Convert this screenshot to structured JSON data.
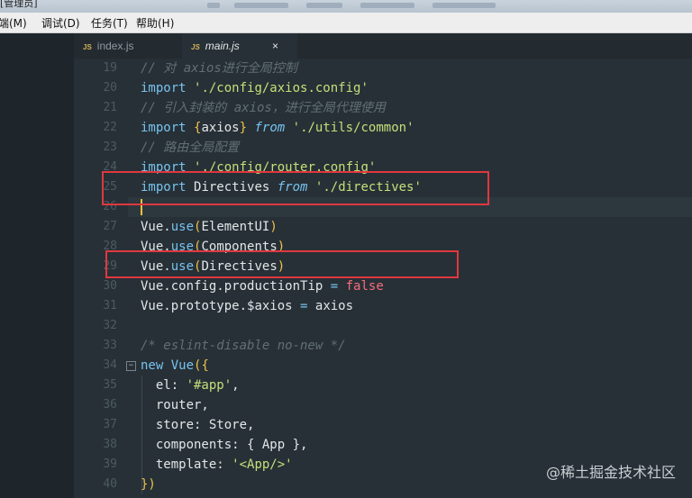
{
  "titlebar": {
    "text": "[管理员]"
  },
  "menu": [
    {
      "label": "客端(M)"
    },
    {
      "label": "调试(D)"
    },
    {
      "label": "任务(T)"
    },
    {
      "label": "帮助(H)"
    }
  ],
  "tabs": [
    {
      "label": "index.js",
      "icon": "js-file-icon",
      "active": false
    },
    {
      "label": "main.js",
      "icon": "js-file-icon",
      "active": true,
      "close": "×"
    }
  ],
  "editor": {
    "lines": [
      {
        "n": "19",
        "tokens": [
          {
            "t": "// 对 axios进行全局控制",
            "c": "cm"
          }
        ]
      },
      {
        "n": "20",
        "tokens": [
          {
            "t": "import",
            "c": "kw"
          },
          {
            "t": " "
          },
          {
            "t": "'./config/axios.config'",
            "c": "str"
          }
        ]
      },
      {
        "n": "21",
        "tokens": [
          {
            "t": "// 引入封装的 axios，进行全局代理使用",
            "c": "cm"
          }
        ]
      },
      {
        "n": "22",
        "tokens": [
          {
            "t": "import",
            "c": "kw"
          },
          {
            "t": " "
          },
          {
            "t": "{",
            "c": "pn"
          },
          {
            "t": "axios",
            "c": "id"
          },
          {
            "t": "}",
            "c": "pn"
          },
          {
            "t": " "
          },
          {
            "t": "from",
            "c": "kwi"
          },
          {
            "t": " "
          },
          {
            "t": "'./utils/common'",
            "c": "str"
          }
        ]
      },
      {
        "n": "23",
        "tokens": [
          {
            "t": "// 路由全局配置",
            "c": "cm"
          }
        ]
      },
      {
        "n": "24",
        "tokens": [
          {
            "t": "import",
            "c": "kw"
          },
          {
            "t": " "
          },
          {
            "t": "'./config/router.config'",
            "c": "str"
          }
        ]
      },
      {
        "n": "25",
        "tokens": [
          {
            "t": "import",
            "c": "kw"
          },
          {
            "t": " "
          },
          {
            "t": "Directives",
            "c": "id"
          },
          {
            "t": " "
          },
          {
            "t": "from",
            "c": "kwi"
          },
          {
            "t": " "
          },
          {
            "t": "'./directives'",
            "c": "str"
          }
        ]
      },
      {
        "n": "26",
        "tokens": []
      },
      {
        "n": "27",
        "tokens": [
          {
            "t": "Vue",
            "c": "id"
          },
          {
            "t": ".",
            "c": "id"
          },
          {
            "t": "use",
            "c": "fn"
          },
          {
            "t": "(",
            "c": "pn"
          },
          {
            "t": "ElementUI",
            "c": "id"
          },
          {
            "t": ")",
            "c": "pn"
          }
        ]
      },
      {
        "n": "28",
        "tokens": [
          {
            "t": "Vue",
            "c": "id"
          },
          {
            "t": ".",
            "c": "id"
          },
          {
            "t": "use",
            "c": "fn"
          },
          {
            "t": "(",
            "c": "pn"
          },
          {
            "t": "Components",
            "c": "id"
          },
          {
            "t": ")",
            "c": "pn"
          }
        ]
      },
      {
        "n": "29",
        "tokens": [
          {
            "t": "Vue",
            "c": "id"
          },
          {
            "t": ".",
            "c": "id"
          },
          {
            "t": "use",
            "c": "fn"
          },
          {
            "t": "(",
            "c": "pn"
          },
          {
            "t": "Directives",
            "c": "id"
          },
          {
            "t": ")",
            "c": "pn"
          }
        ]
      },
      {
        "n": "30",
        "tokens": [
          {
            "t": "Vue",
            "c": "id"
          },
          {
            "t": ".config.productionTip",
            "c": "id"
          },
          {
            "t": " = ",
            "c": "op"
          },
          {
            "t": "false",
            "c": "bool"
          }
        ]
      },
      {
        "n": "31",
        "tokens": [
          {
            "t": "Vue",
            "c": "id"
          },
          {
            "t": ".prototype.$axios",
            "c": "id"
          },
          {
            "t": " = ",
            "c": "op"
          },
          {
            "t": "axios",
            "c": "id"
          }
        ]
      },
      {
        "n": "32",
        "tokens": []
      },
      {
        "n": "33",
        "tokens": [
          {
            "t": "/* eslint-disable no-new */",
            "c": "cm"
          }
        ]
      },
      {
        "n": "34",
        "fold": "−",
        "tokens": [
          {
            "t": "new",
            "c": "kw"
          },
          {
            "t": " "
          },
          {
            "t": "Vue",
            "c": "fn"
          },
          {
            "t": "({",
            "c": "pn"
          }
        ]
      },
      {
        "n": "35",
        "tokens": [
          {
            "t": "  el: ",
            "c": "prop"
          },
          {
            "t": "'#app'",
            "c": "str"
          },
          {
            "t": ",",
            "c": "id"
          }
        ]
      },
      {
        "n": "36",
        "tokens": [
          {
            "t": "  router,",
            "c": "prop"
          }
        ]
      },
      {
        "n": "37",
        "tokens": [
          {
            "t": "  store: Store,",
            "c": "prop"
          }
        ]
      },
      {
        "n": "38",
        "tokens": [
          {
            "t": "  components: ",
            "c": "prop"
          },
          {
            "t": "{",
            "c": "id"
          },
          {
            "t": " App ",
            "c": "id"
          },
          {
            "t": "}",
            "c": "id"
          },
          {
            "t": ",",
            "c": "id"
          }
        ]
      },
      {
        "n": "39",
        "tokens": [
          {
            "t": "  template: ",
            "c": "prop"
          },
          {
            "t": "'<App/>'",
            "c": "str"
          }
        ]
      },
      {
        "n": "40",
        "tokens": [
          {
            "t": "})",
            "c": "pn"
          }
        ]
      }
    ]
  },
  "watermark": "@稀土掘金技术社区",
  "colors": {
    "background": "#273036",
    "highlight_box": "#e0383f",
    "keyword": "#77c3f0",
    "string": "#c2e07a",
    "comment": "#616e76",
    "paren": "#f0c24a",
    "boolean": "#f56d7b"
  }
}
